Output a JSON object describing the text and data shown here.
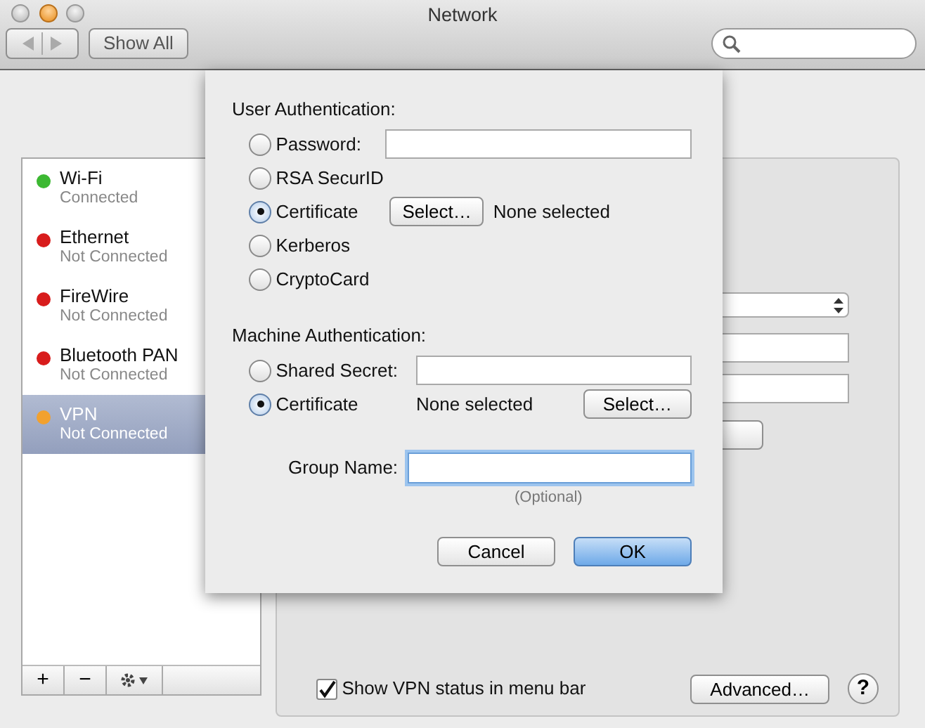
{
  "window": {
    "title": "Network"
  },
  "toolbar": {
    "show_all": "Show All"
  },
  "sidebar": {
    "items": [
      {
        "name": "Wi-Fi",
        "status": "Connected",
        "color": "#3cb832",
        "selected": false
      },
      {
        "name": "Ethernet",
        "status": "Not Connected",
        "color": "#d81c1c",
        "selected": false
      },
      {
        "name": "FireWire",
        "status": "Not Connected",
        "color": "#d81c1c",
        "selected": false
      },
      {
        "name": "Bluetooth PAN",
        "status": "Not Connected",
        "color": "#d81c1c",
        "selected": false
      },
      {
        "name": "VPN",
        "status": "Not Connected",
        "color": "#f2a12e",
        "selected": true
      }
    ],
    "footer_buttons": [
      "+",
      "−"
    ]
  },
  "sheet": {
    "user_authentication": {
      "heading": "User Authentication:",
      "options": [
        {
          "kind": "field",
          "label": "Password:",
          "selected": false
        },
        {
          "kind": "plain",
          "label": "RSA SecurID",
          "selected": false
        },
        {
          "kind": "select",
          "label": "Certificate",
          "selected": true,
          "button": "Select…",
          "note": "None selected"
        },
        {
          "kind": "plain",
          "label": "Kerberos",
          "selected": false
        },
        {
          "kind": "plain",
          "label": "CryptoCard",
          "selected": false
        }
      ]
    },
    "machine_authentication": {
      "heading": "Machine Authentication:",
      "options": [
        {
          "kind": "field",
          "label": "Shared Secret:",
          "selected": false
        },
        {
          "kind": "note_select",
          "label": "Certificate",
          "selected": true,
          "note": "None selected",
          "button": "Select…"
        }
      ]
    },
    "group_name": {
      "label": "Group Name:",
      "hint": "(Optional)"
    },
    "buttons": [
      {
        "label": "Cancel",
        "default": false
      },
      {
        "label": "OK",
        "default": true
      }
    ]
  },
  "footer": {
    "checkbox": {
      "label": "Show VPN status in menu bar",
      "checked": true
    },
    "advanced": "Advanced…",
    "help": "?"
  }
}
